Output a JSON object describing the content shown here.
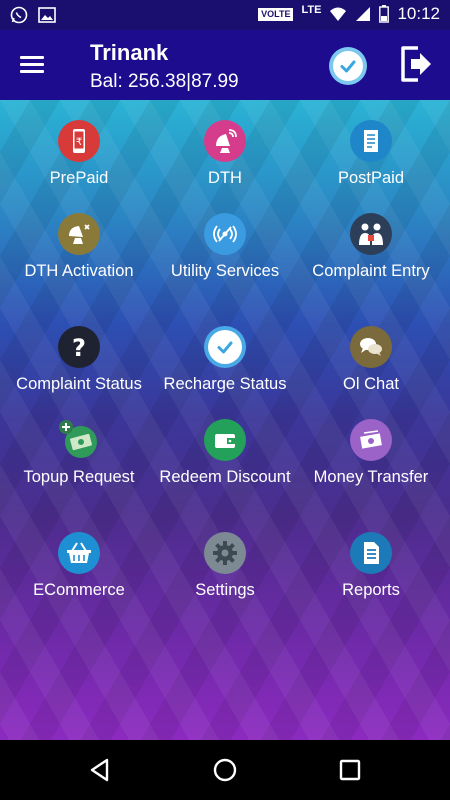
{
  "status_bar": {
    "network_badge": "VOLTE",
    "network_type": "LTE",
    "time": "10:12",
    "icons": [
      "whatsapp-icon",
      "image-icon",
      "wifi-icon",
      "signal-icon",
      "battery-icon"
    ]
  },
  "header": {
    "user_name": "Trinank",
    "balance": "Bal: 256.38|87.99",
    "colors": {
      "app_bar": "#1d0c8e",
      "status_bar": "#1a0f6e"
    }
  },
  "grid": {
    "items": [
      {
        "label": "PrePaid",
        "icon": "prepaid-mobile-icon",
        "color": "#d83a3a"
      },
      {
        "label": "DTH",
        "icon": "dth-satellite-icon",
        "color": "#d63c8c"
      },
      {
        "label": "PostPaid",
        "icon": "postpaid-bill-icon",
        "color": "#1f86c9"
      },
      {
        "label": "DTH Activation",
        "icon": "satellite-dish-icon",
        "color": "#8a7a3a"
      },
      {
        "label": "Utility Services",
        "icon": "wireless-signal-icon",
        "color": "#3a9be0"
      },
      {
        "label": "Complaint Entry",
        "icon": "complaint-entry-icon",
        "color": "#2c3e58"
      },
      {
        "label": "Complaint Status",
        "icon": "question-icon",
        "color": "#1f2230"
      },
      {
        "label": "Recharge Status",
        "icon": "check-circle-icon",
        "color": "#49a8e6"
      },
      {
        "label": "Ol Chat",
        "icon": "chat-bubbles-icon",
        "color": "#7b6a3c"
      },
      {
        "label": "Topup Request",
        "icon": "money-add-icon",
        "color": "#2f9a5a"
      },
      {
        "label": "Redeem Discount",
        "icon": "wallet-icon",
        "color": "#23a05a"
      },
      {
        "label": "Money Transfer",
        "icon": "money-transfer-icon",
        "color": "#9b63c8"
      },
      {
        "label": "ECommerce",
        "icon": "shopping-basket-icon",
        "color": "#1f8fd3"
      },
      {
        "label": "Settings",
        "icon": "gear-icon",
        "color": "#7d8a94"
      },
      {
        "label": "Reports",
        "icon": "report-document-icon",
        "color": "#1d7ab8"
      }
    ]
  },
  "nav_bar": {
    "buttons": [
      "back-icon",
      "home-icon",
      "recents-icon"
    ]
  }
}
